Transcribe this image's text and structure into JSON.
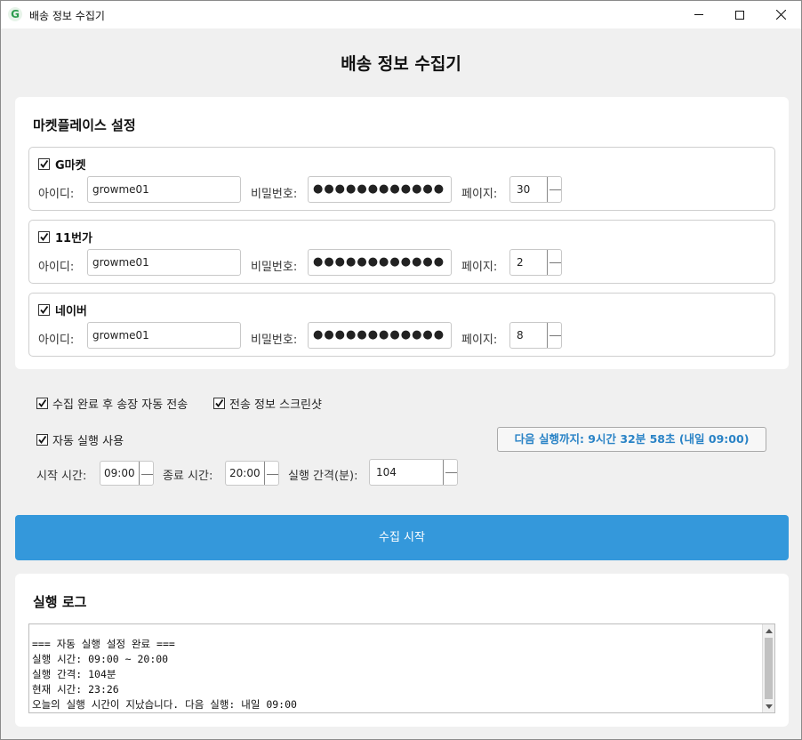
{
  "window": {
    "title": "배송 정보 수집기",
    "icon_glyph": "G"
  },
  "app": {
    "heading": "배송 정보 수집기"
  },
  "marketplace": {
    "section_title": "마켓플레이스 설정",
    "id_label": "아이디:",
    "pw_label": "비밀번호:",
    "page_label": "페이지:",
    "items": [
      {
        "name": "G마켓",
        "checked": true,
        "id_value": "growme01",
        "pw_value": "●●●●●●●●●●●●",
        "pages": "30"
      },
      {
        "name": "11번가",
        "checked": true,
        "id_value": "growme01",
        "pw_value": "●●●●●●●●●●●●",
        "pages": "2"
      },
      {
        "name": "네이버",
        "checked": true,
        "id_value": "growme01",
        "pw_value": "●●●●●●●●●●●●",
        "pages": "8"
      }
    ]
  },
  "options": {
    "auto_send_label": "수집 완료 후 송장 자동 전송",
    "screenshot_label": "전송 정보 스크린샷",
    "auto_run_label": "자동 실행 사용",
    "next_run_text": "다음 실행까지: 9시간 32분 58초 (내일 09:00)",
    "start_time_label": "시작 시간:",
    "start_time_value": "09:00",
    "end_time_label": "종료 시간:",
    "end_time_value": "20:00",
    "interval_label": "실행 간격(분):",
    "interval_value": "104"
  },
  "actions": {
    "start_label": "수집 시작"
  },
  "log": {
    "section_title": "실행 로그",
    "lines": "=== 자동 실행 설정 완료 ===\n실행 시간: 09:00 ~ 20:00\n실행 간격: 104분\n현재 시간: 23:26\n오늘의 실행 시간이 지났습니다. 다음 실행: 내일 09:00"
  },
  "colors": {
    "accent": "#3498db",
    "next_run_text": "#2a83c6",
    "background": "#f0f0f0"
  }
}
